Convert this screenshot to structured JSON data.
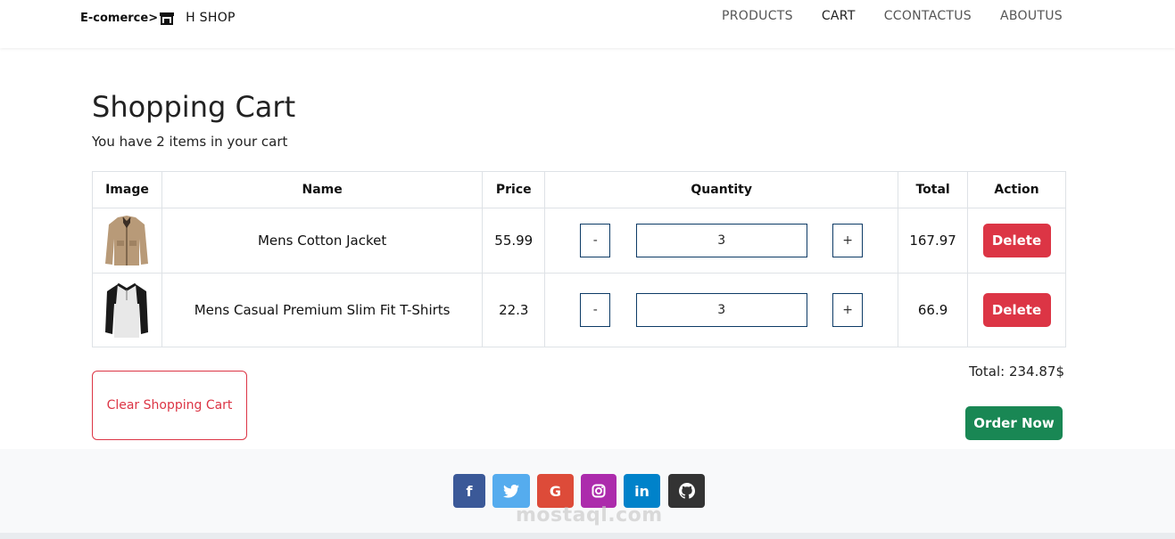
{
  "navbar": {
    "brand": "E-comerce>",
    "brand_icon": "store-icon",
    "shop_name": "H SHOP",
    "links": [
      "PRODUCTS",
      "CART",
      "CCONTACTUS",
      "ABOUTUS"
    ],
    "active": "CART"
  },
  "page": {
    "title": "Shopping Cart",
    "subtitle": "You have 2 items in your cart"
  },
  "table": {
    "headers": [
      "Image",
      "Name",
      "Price",
      "Quantity",
      "Total",
      "Action"
    ],
    "rows": [
      {
        "image": "jacket-image",
        "name": "Mens Cotton Jacket",
        "price": "55.99",
        "quantity": "3",
        "total": "167.97",
        "minus": "-",
        "plus": "+",
        "action": "Delete"
      },
      {
        "image": "tshirt-image",
        "name": "Mens Casual Premium Slim Fit T-Shirts",
        "price": "22.3",
        "quantity": "3",
        "total": "66.9",
        "minus": "-",
        "plus": "+",
        "action": "Delete"
      }
    ]
  },
  "actions": {
    "clear": "Clear Shopping Cart",
    "total": "Total: 234.87$",
    "order": "Order Now"
  },
  "footer": {
    "socials": [
      {
        "icon": "facebook-icon",
        "glyph": "f",
        "color": "#3b5998"
      },
      {
        "icon": "twitter-icon",
        "glyph": "🐦",
        "color": "#55acee"
      },
      {
        "icon": "google-icon",
        "glyph": "G",
        "color": "#dd4b39"
      },
      {
        "icon": "instagram-icon",
        "glyph": "◎",
        "color": "#ac2bac"
      },
      {
        "icon": "linkedin-icon",
        "glyph": "in",
        "color": "#0082ca"
      },
      {
        "icon": "github-icon",
        "glyph": "●",
        "color": "#333333"
      }
    ],
    "watermark": "mostaql.com"
  },
  "colors": {
    "danger": "#dc3545",
    "success": "#198754",
    "input_border": "#0d3b66"
  }
}
